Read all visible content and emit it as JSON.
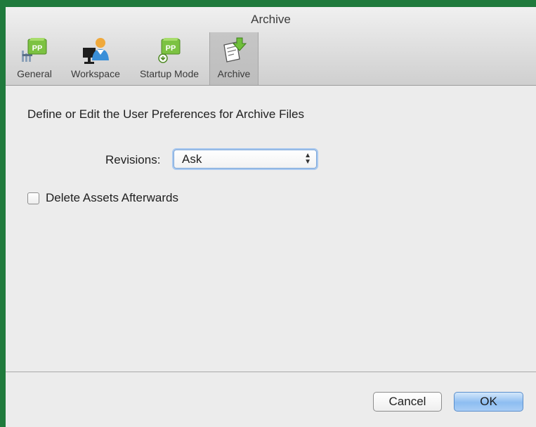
{
  "window": {
    "title": "Archive"
  },
  "toolbar": {
    "items": [
      {
        "label": "General",
        "icon": "pp-general-icon",
        "selected": false
      },
      {
        "label": "Workspace",
        "icon": "workspace-user-icon",
        "selected": false
      },
      {
        "label": "Startup Mode",
        "icon": "pp-startup-icon",
        "selected": false
      },
      {
        "label": "Archive",
        "icon": "archive-download-icon",
        "selected": true
      }
    ]
  },
  "content": {
    "heading": "Define or Edit the User Preferences for Archive Files",
    "revisions": {
      "label": "Revisions:",
      "value": "Ask",
      "arrows": "▲▼"
    },
    "delete_assets": {
      "label": "Delete Assets Afterwards",
      "checked": false
    }
  },
  "buttons": {
    "cancel": "Cancel",
    "ok": "OK"
  },
  "colors": {
    "ok_button": "#8dbdf1",
    "focus_ring": "#a8c8ef",
    "pp_green": "#7cc242"
  }
}
